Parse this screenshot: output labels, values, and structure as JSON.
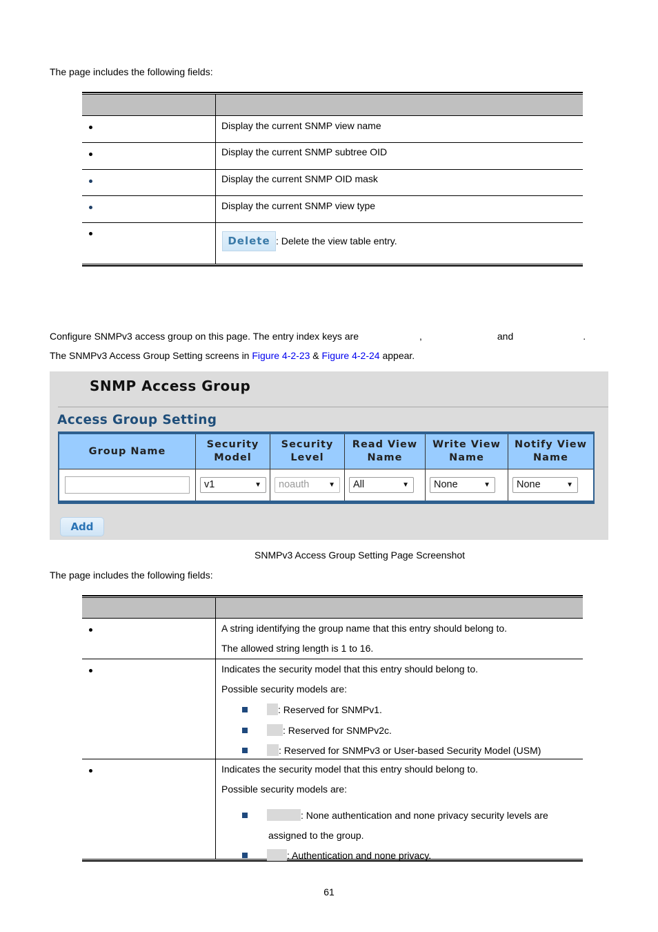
{
  "intro_fields_1": "The page includes the following fields:",
  "view_table": {
    "rows": [
      {
        "description": "Display the current SNMP view name",
        "bullet": "black"
      },
      {
        "description": "Display the current SNMP subtree OID",
        "bullet": "black"
      },
      {
        "description": "Display the current SNMP OID mask",
        "bullet": "blue"
      },
      {
        "description": "Display the current SNMP view type",
        "bullet": "blue"
      },
      {
        "button_label": "Delete",
        "description": ": Delete the view table entry.",
        "bullet": "black"
      }
    ]
  },
  "section_text": {
    "line1_a": "Configure SNMPv3 access group on this page. The entry index keys are",
    "line1_comma": ",",
    "line1_and": "and",
    "line1_period": ".",
    "line2_a": "The SNMPv3 Access Group Setting screens in ",
    "link1": "Figure 4-2-23",
    "line2_amp": " & ",
    "link2": "Figure 4-2-24",
    "line2_b": " appear."
  },
  "screenshot": {
    "title": "SNMP Access Group",
    "subtitle": "Access Group Setting",
    "headers": [
      "Group Name",
      "Security Model",
      "Security Level",
      "Read View Name",
      "Write View Name",
      "Notify View Name"
    ],
    "header_lines": [
      [
        "Group Name"
      ],
      [
        "Security",
        "Model"
      ],
      [
        "Security",
        "Level"
      ],
      [
        "Read View",
        "Name"
      ],
      [
        "Write View",
        "Name"
      ],
      [
        "Notify View",
        "Name"
      ]
    ],
    "group_name_value": "",
    "security_model": "v1",
    "security_level": "noauth",
    "read_view": "All",
    "write_view": "None",
    "notify_view": "None",
    "add_label": "Add",
    "colors": {
      "panel_bg": "#dcdcdc",
      "header_bg": "#99ccff",
      "border": "#2e5f8f",
      "subtitle": "#1f4e7a"
    }
  },
  "caption": "SNMPv3 Access Group Setting Page Screenshot",
  "intro_fields_2": "The page includes the following fields:",
  "group_table": {
    "row1": {
      "lines": [
        "A string identifying the group name that this entry should belong to.",
        "The allowed string length is 1 to 16."
      ]
    },
    "row2": {
      "line1": "Indicates the security model that this entry should belong to.",
      "line2": "Possible security models are:",
      "items": [
        ": Reserved for SNMPv1.",
        ": Reserved for SNMPv2c.",
        ": Reserved for SNMPv3 or User-based Security Model (USM)"
      ]
    },
    "row3": {
      "line1": "Indicates the security model that this entry should belong to.",
      "line2": "Possible security models are:",
      "items": [
        ": None authentication and none privacy security levels are",
        ": Authentication and none privacy."
      ],
      "item1_cont": "assigned to the group."
    }
  },
  "page_number": "61"
}
